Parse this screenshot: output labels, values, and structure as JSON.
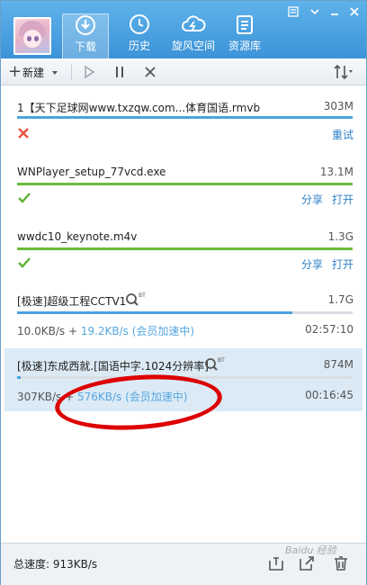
{
  "nav": {
    "tabs": [
      {
        "label": "下载",
        "icon": "download-icon",
        "active": true
      },
      {
        "label": "历史",
        "icon": "history-icon"
      },
      {
        "label": "旋风空间",
        "icon": "cloud-icon"
      },
      {
        "label": "资源库",
        "icon": "library-icon"
      }
    ]
  },
  "toolbar": {
    "new_label": "新建"
  },
  "tasks": [
    {
      "title": "1【天下足球网www.txzqw.com...体育国语.rmvb",
      "size": "303M",
      "progress": 1.0,
      "bar_color": "#4aa3df",
      "status_icon": "error-x-icon",
      "action": "重试"
    },
    {
      "title": "WNPlayer_setup_77vcd.exe",
      "size": "13.1M",
      "progress": 1.0,
      "bar_color": "#6dbb3c",
      "status_icon": "check-icon",
      "share": "分享",
      "open": "打开"
    },
    {
      "title": "wwdc10_keynote.m4v",
      "size": "1.3G",
      "progress": 1.0,
      "bar_color": "#6dbb3c",
      "status_icon": "check-icon",
      "share": "分享",
      "open": "打开"
    },
    {
      "title": "[极速]超级工程CCTV1",
      "size": "1.7G",
      "progress": 0.82,
      "bar_color": "#4aa3df",
      "speed": "10.0KB/s",
      "plus": " + ",
      "accel": "19.2KB/s (会员加速中)",
      "time": "02:57:10"
    },
    {
      "title": "[极速]东成西就.[国语中字.1024分辨率]",
      "size": "874M",
      "progress": 0.01,
      "bar_color": "#4aa3df",
      "speed": "307KB/s",
      "plus": " + ",
      "accel": "576KB/s (会员加速中)",
      "time": "00:16:45"
    }
  ],
  "bt_badge": "BT",
  "footer": {
    "speed": "总速度: 913KB/s"
  },
  "watermark": "Baidu 经验",
  "colors": {
    "header": "#3c93d8",
    "accent": "#2e7fc7",
    "accel_text": "#56a6e0",
    "success": "#6dbb3c",
    "error": "#e8543e"
  }
}
